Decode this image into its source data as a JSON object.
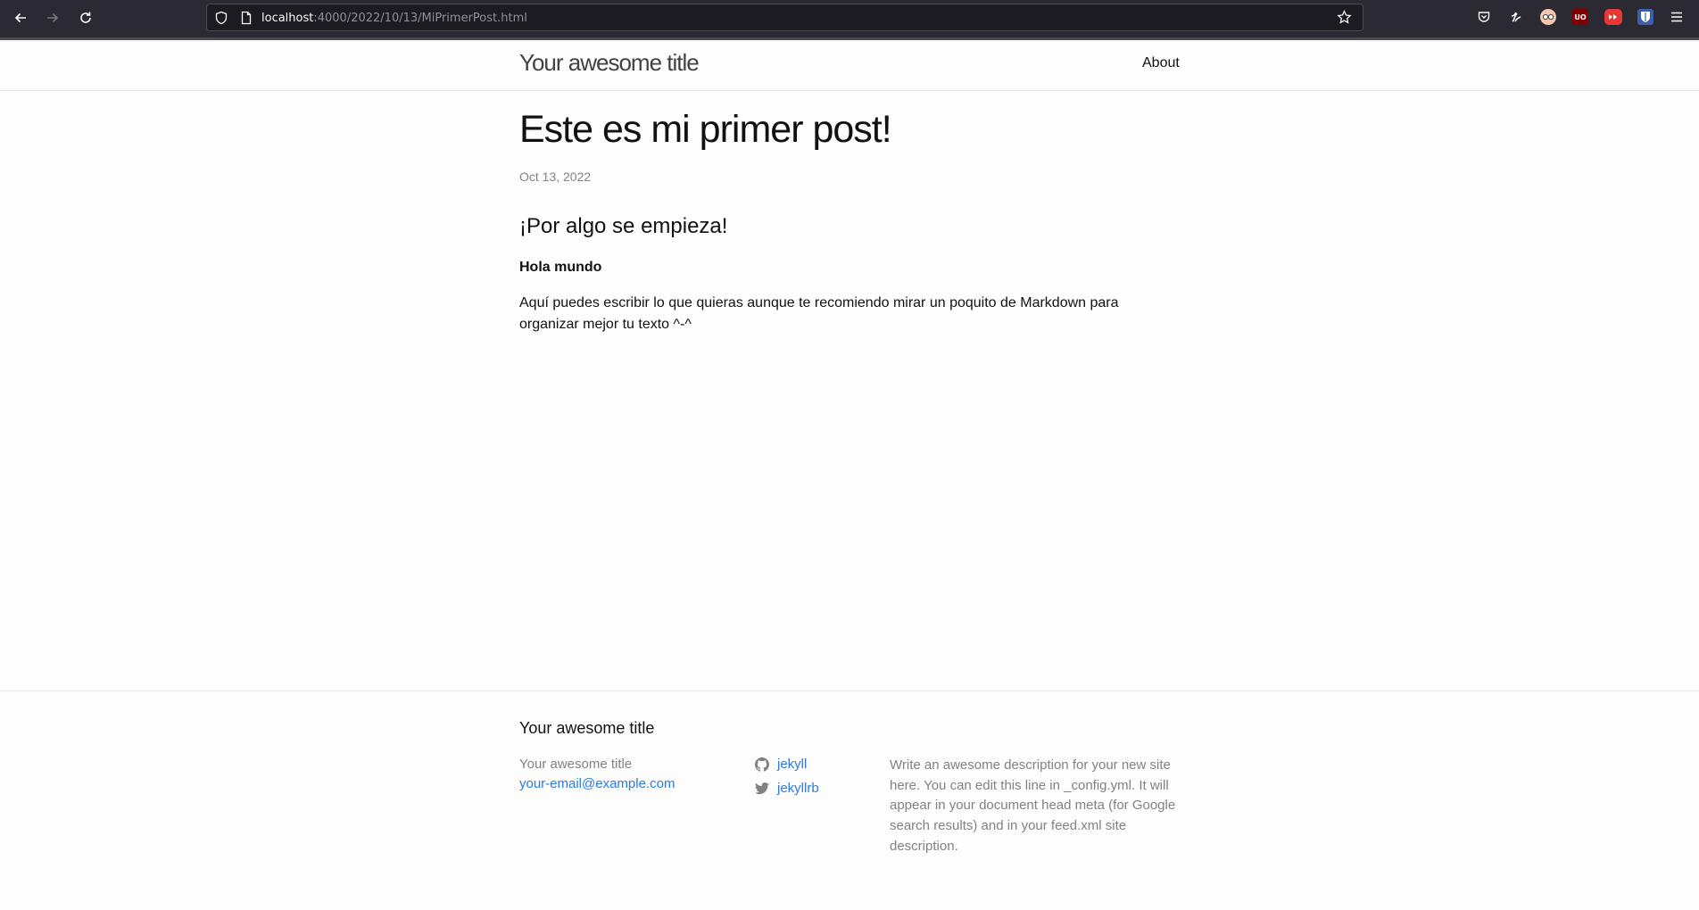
{
  "browser": {
    "url_host": "localhost",
    "url_path": ":4000/2022/10/13/MiPrimerPost.html",
    "icons": [
      "back-icon",
      "forward-icon",
      "reload-icon",
      "shield-icon",
      "page-icon",
      "bookmark-star-icon",
      "pocket-icon",
      "extension-icon",
      "extension-icon",
      "ublock-icon",
      "extension-icon",
      "extension-icon",
      "menu-icon"
    ],
    "ublock_label": "UO"
  },
  "header": {
    "site_title": "Your awesome title",
    "nav": {
      "about": "About"
    }
  },
  "post": {
    "title": "Este es mi primer post!",
    "date": "Oct 13, 2022",
    "subheading": "¡Por algo se empieza!",
    "bold_line": "Hola mundo",
    "paragraph": "Aquí puedes escribir lo que quieras aunque te recomiendo mirar un poquito de Markdown para organizar mejor tu texto ^-^"
  },
  "footer": {
    "heading": "Your awesome title",
    "name": "Your awesome title",
    "email": "your-email@example.com",
    "github_username": "jekyll",
    "twitter_username": "jekyllrb",
    "description": "Write an awesome description for your new site here. You can edit this line in _config.yml. It will appear in your document head meta (for Google search results) and in your feed.xml site description."
  },
  "colors": {
    "link": "#2a7ae2",
    "muted": "#828282",
    "chrome_bg": "#2b2a33"
  }
}
